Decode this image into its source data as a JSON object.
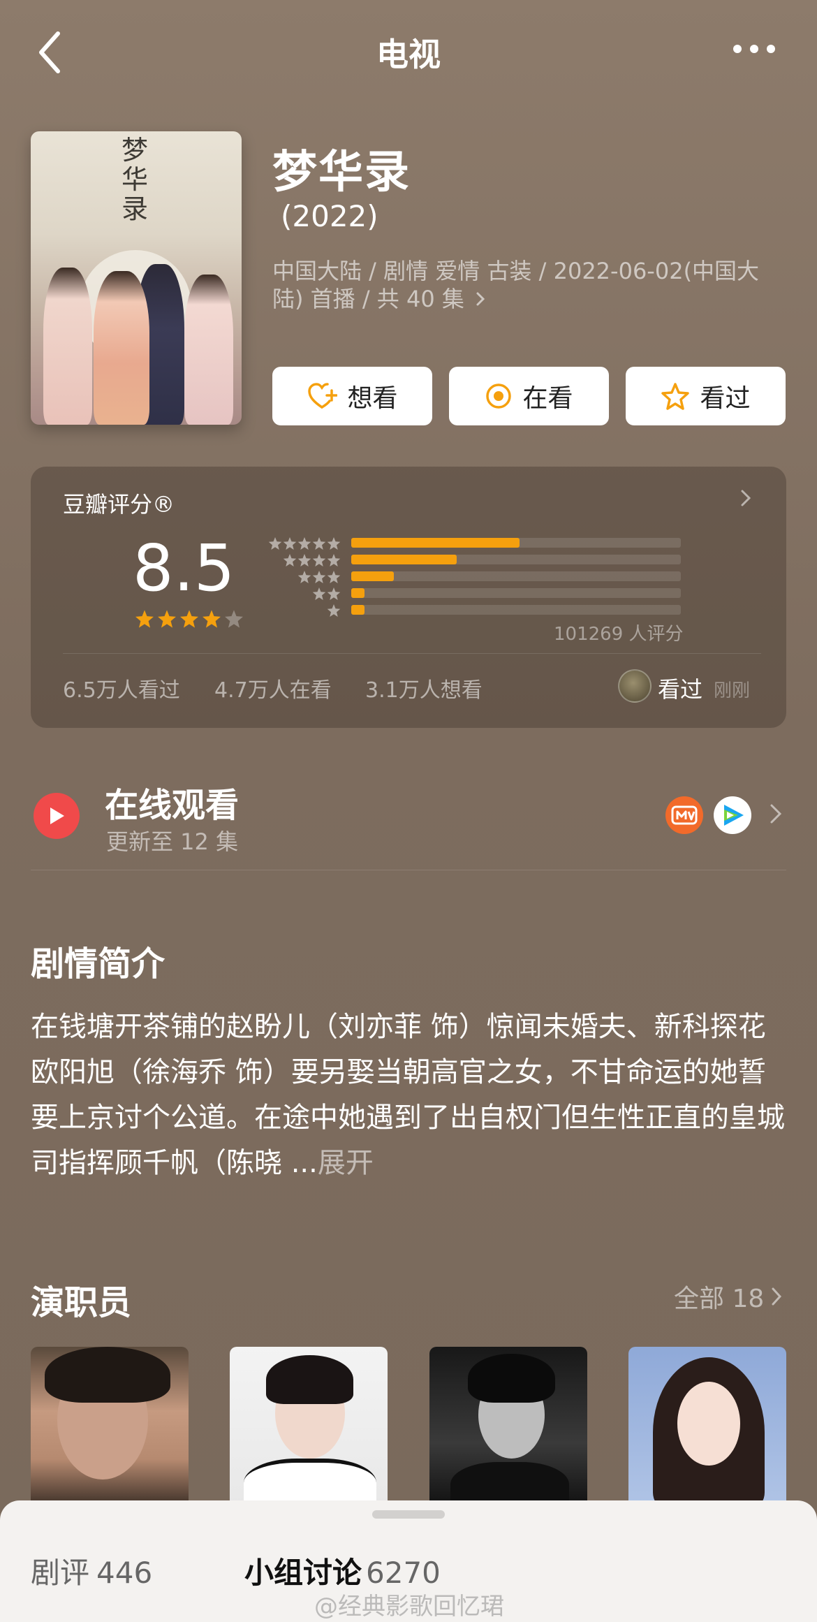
{
  "nav": {
    "title": "电视"
  },
  "show": {
    "title": "梦华录",
    "year": "(2022)",
    "meta": "中国大陆 / 剧情 爱情 古装 / 2022-06-02(中国大陆) 首播 / 共 40 集",
    "poster_title": "梦华录"
  },
  "actions": [
    {
      "label": "想看",
      "icon": "heart-plus-icon"
    },
    {
      "label": "在看",
      "icon": "target-circle-icon"
    },
    {
      "label": "看过",
      "icon": "star-outline-icon"
    }
  ],
  "rating": {
    "label": "豆瓣评分®",
    "score": "8.5",
    "stars": 4,
    "distribution": [
      {
        "stars": 5,
        "fraction": 0.51
      },
      {
        "stars": 4,
        "fraction": 0.32
      },
      {
        "stars": 3,
        "fraction": 0.13
      },
      {
        "stars": 2,
        "fraction": 0.04
      },
      {
        "stars": 1,
        "fraction": 0.04
      }
    ],
    "count_text": "101269 人评分",
    "stats": [
      "6.5万人看过",
      "4.7万人在看",
      "3.1万人想看"
    ],
    "user_status": "看过",
    "user_time": "刚刚"
  },
  "watch": {
    "title": "在线观看",
    "subtitle": "更新至 12 集",
    "providers": [
      "mango-tv-icon",
      "tencent-video-icon"
    ]
  },
  "synopsis": {
    "heading": "剧情简介",
    "text": "在钱塘开茶铺的赵盼儿（刘亦菲 饰）惊闻未婚夫、新科探花欧阳旭（徐海乔 饰）要另娶当朝高官之女，不甘命运的她誓要上京讨个公道。在途中她遇到了出自权门但生性正直的皇城司指挥顾千帆（陈晓 ...",
    "expand": "展开"
  },
  "cast": {
    "heading": "演职员",
    "all_label": "全部 18"
  },
  "bottom_tabs": [
    {
      "label": "剧评",
      "count": "446"
    },
    {
      "label": "小组讨论",
      "count": "6270"
    }
  ],
  "watermark": "@经典影歌回忆珺",
  "colors": {
    "accent": "#f5a00e",
    "play": "#f04a4a"
  }
}
